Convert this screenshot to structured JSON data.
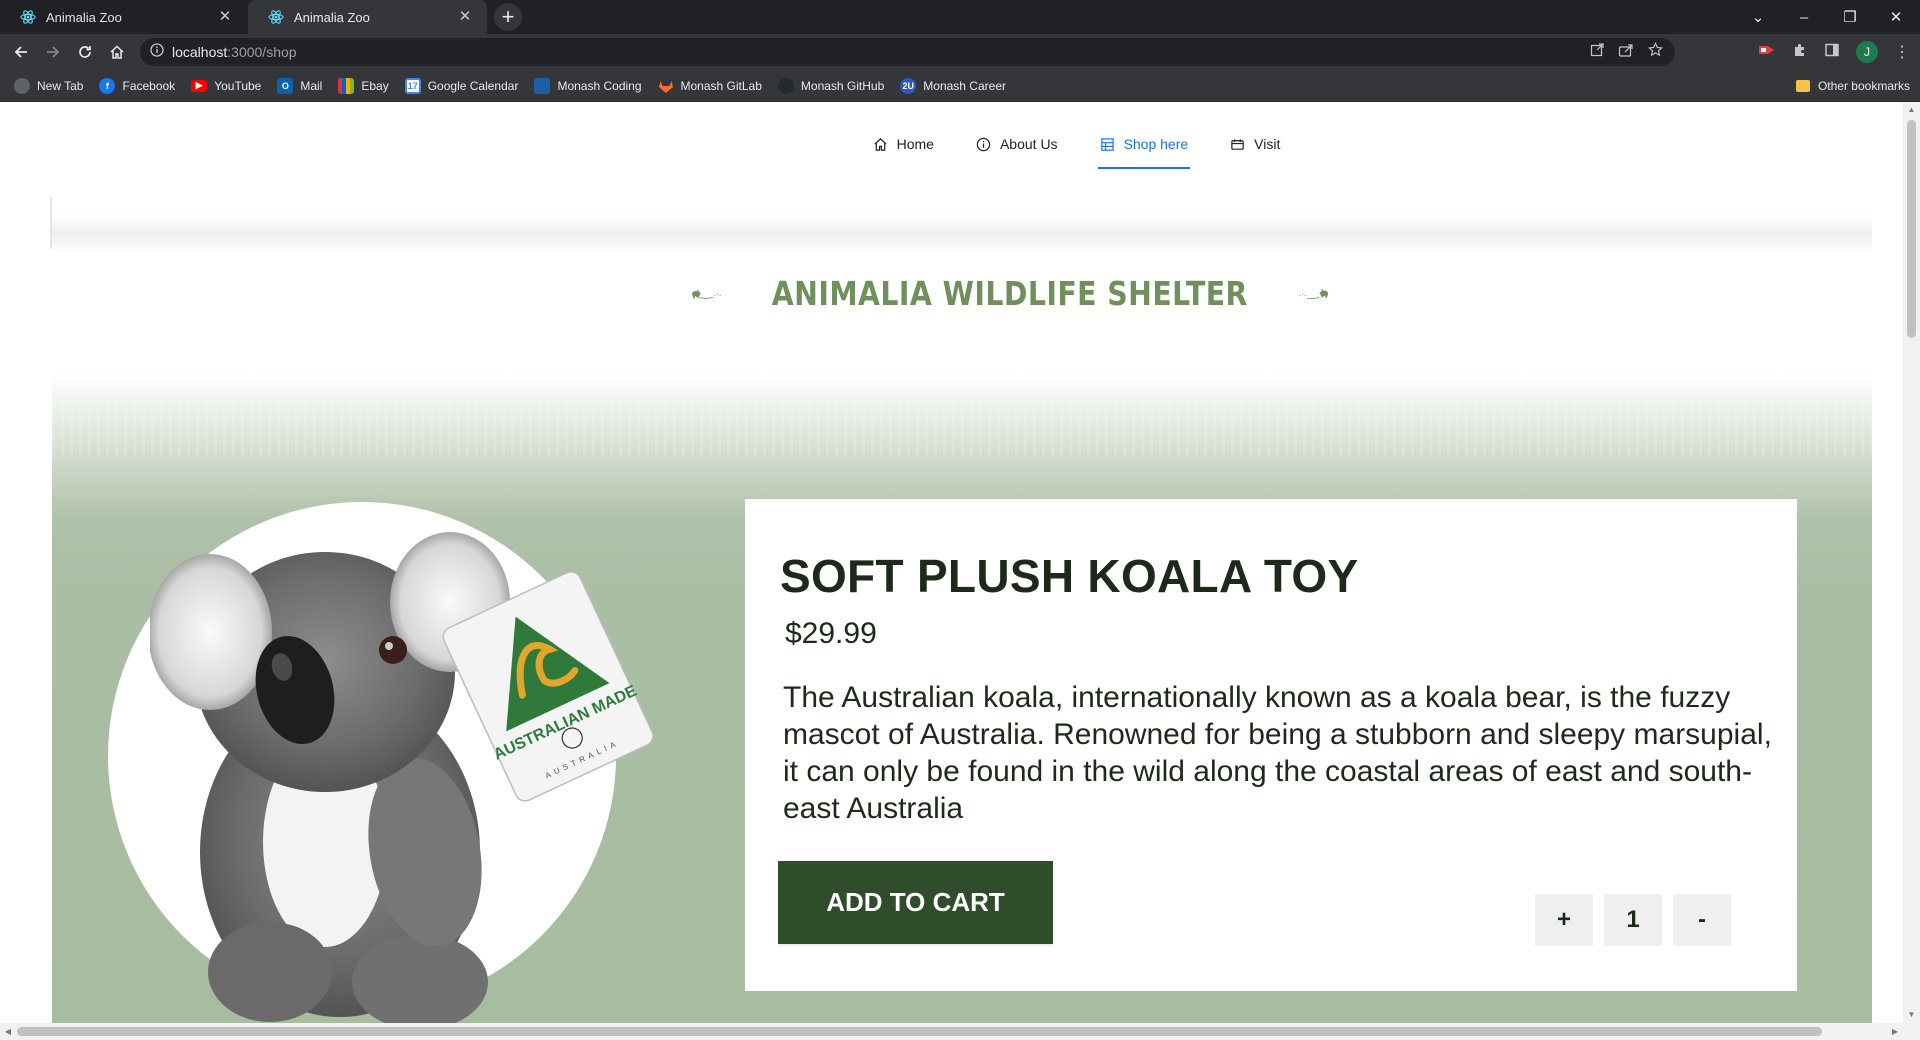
{
  "browser": {
    "tabs": [
      {
        "title": "Animalia Zoo",
        "active": false
      },
      {
        "title": "Animalia Zoo",
        "active": true
      }
    ],
    "address": {
      "host": "localhost",
      "path": ":3000/shop"
    },
    "profile_initial": "J",
    "bookmarks": [
      {
        "label": "New Tab",
        "icon": "globe-icon",
        "color": "#5f6368"
      },
      {
        "label": "Facebook",
        "icon": "facebook-icon",
        "color": "#1877f2"
      },
      {
        "label": "YouTube",
        "icon": "youtube-icon",
        "color": "#ff0000"
      },
      {
        "label": "Mail",
        "icon": "outlook-icon",
        "color": "#0a64ad"
      },
      {
        "label": "Ebay",
        "icon": "ebay-icon",
        "color": "#e53238"
      },
      {
        "label": "Google Calendar",
        "icon": "calendar-icon",
        "color": "#4285f4"
      },
      {
        "label": "Monash Coding",
        "icon": "monash-icon",
        "color": "#1f5fa8"
      },
      {
        "label": "Monash  GitLab",
        "icon": "gitlab-icon",
        "color": "#fc6d26"
      },
      {
        "label": "Monash GitHub",
        "icon": "github-icon",
        "color": "#24292f"
      },
      {
        "label": "Monash Career",
        "icon": "career-icon",
        "color": "#2b59c3"
      }
    ],
    "other_bookmarks": "Other bookmarks"
  },
  "site": {
    "nav": [
      {
        "label": "Home",
        "icon": "home-icon",
        "active": false
      },
      {
        "label": "About Us",
        "icon": "info-icon",
        "active": false
      },
      {
        "label": "Shop here",
        "icon": "shop-icon",
        "active": true
      },
      {
        "label": "Visit",
        "icon": "visit-icon",
        "active": false
      }
    ],
    "logo_text": "ANIMALIA WILDLIFE SHELTER",
    "logo_color": "#6f8f5c"
  },
  "product": {
    "title": "SOFT PLUSH KOALA TOY",
    "price": "$29.99",
    "description": "The Australian koala, internationally known as a koala bear, is the fuzzy mascot of Australia. Renowned for being a stubborn and sleepy marsupial, it can only be found in the wild along the coastal areas of east and south-east Australia",
    "add_to_cart": "ADD TO CART",
    "qty_plus": "+",
    "qty_value": "1",
    "qty_minus": "-",
    "tag_text": "AUSTRALIAN MADE",
    "tag_subtext": "AUSTRALIA",
    "accent": "#2f4d2a"
  }
}
